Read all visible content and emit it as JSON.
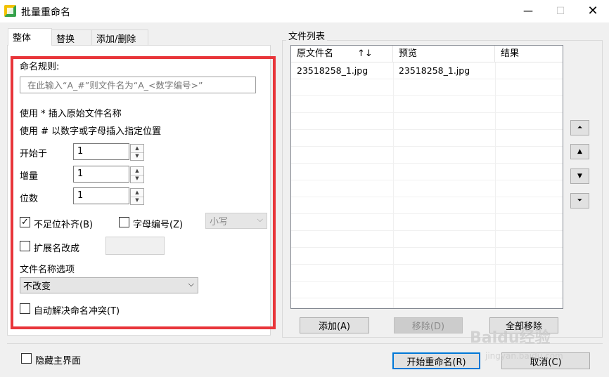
{
  "window": {
    "title": "批量重命名"
  },
  "tabs": [
    "整体",
    "替换",
    "添加/删除"
  ],
  "naming": {
    "rule_label": "命名规则:",
    "rule_placeholder": "在此输入“A_#”则文件名为“A_<数字编号>”",
    "hint1": "使用 * 插入原始文件名称",
    "hint2": "使用 # 以数字或字母插入指定位置",
    "start_label": "开始于",
    "start_value": "1",
    "step_label": "增量",
    "step_value": "1",
    "digits_label": "位数",
    "digits_value": "1",
    "pad_label": "不足位补齐(B)",
    "pad_checked": true,
    "alpha_label": "字母编号(Z)",
    "alpha_checked": false,
    "case_value": "小写",
    "ext_label": "扩展名改成",
    "ext_checked": false,
    "filename_option_label": "文件名称选项",
    "filename_option_value": "不改变",
    "auto_resolve_label": "自动解决命名冲突(T)",
    "auto_resolve_checked": false
  },
  "filelist": {
    "group_title": "文件列表",
    "columns": [
      "原文件名",
      "预览",
      "结果"
    ],
    "sort_arrows": "↑↓",
    "rows": [
      {
        "original": "23518258_1.jpg",
        "preview": "23518258_1.jpg",
        "result": ""
      }
    ],
    "add_button": "添加(A)",
    "remove_button": "移除(D)",
    "remove_all_button": "全部移除"
  },
  "move_buttons": [
    "move-top",
    "move-up",
    "move-down",
    "move-bottom"
  ],
  "footer": {
    "hide_main_label": "隐藏主界面",
    "hide_main_checked": false,
    "start_button": "开始重命名(R)",
    "cancel_button": "取消(C)"
  },
  "watermark": {
    "brand": "Baidu经验",
    "url": "jingyan.baidu.com"
  },
  "colors": {
    "highlight_border": "#e8353a",
    "primary_button_border": "#0078d7"
  }
}
